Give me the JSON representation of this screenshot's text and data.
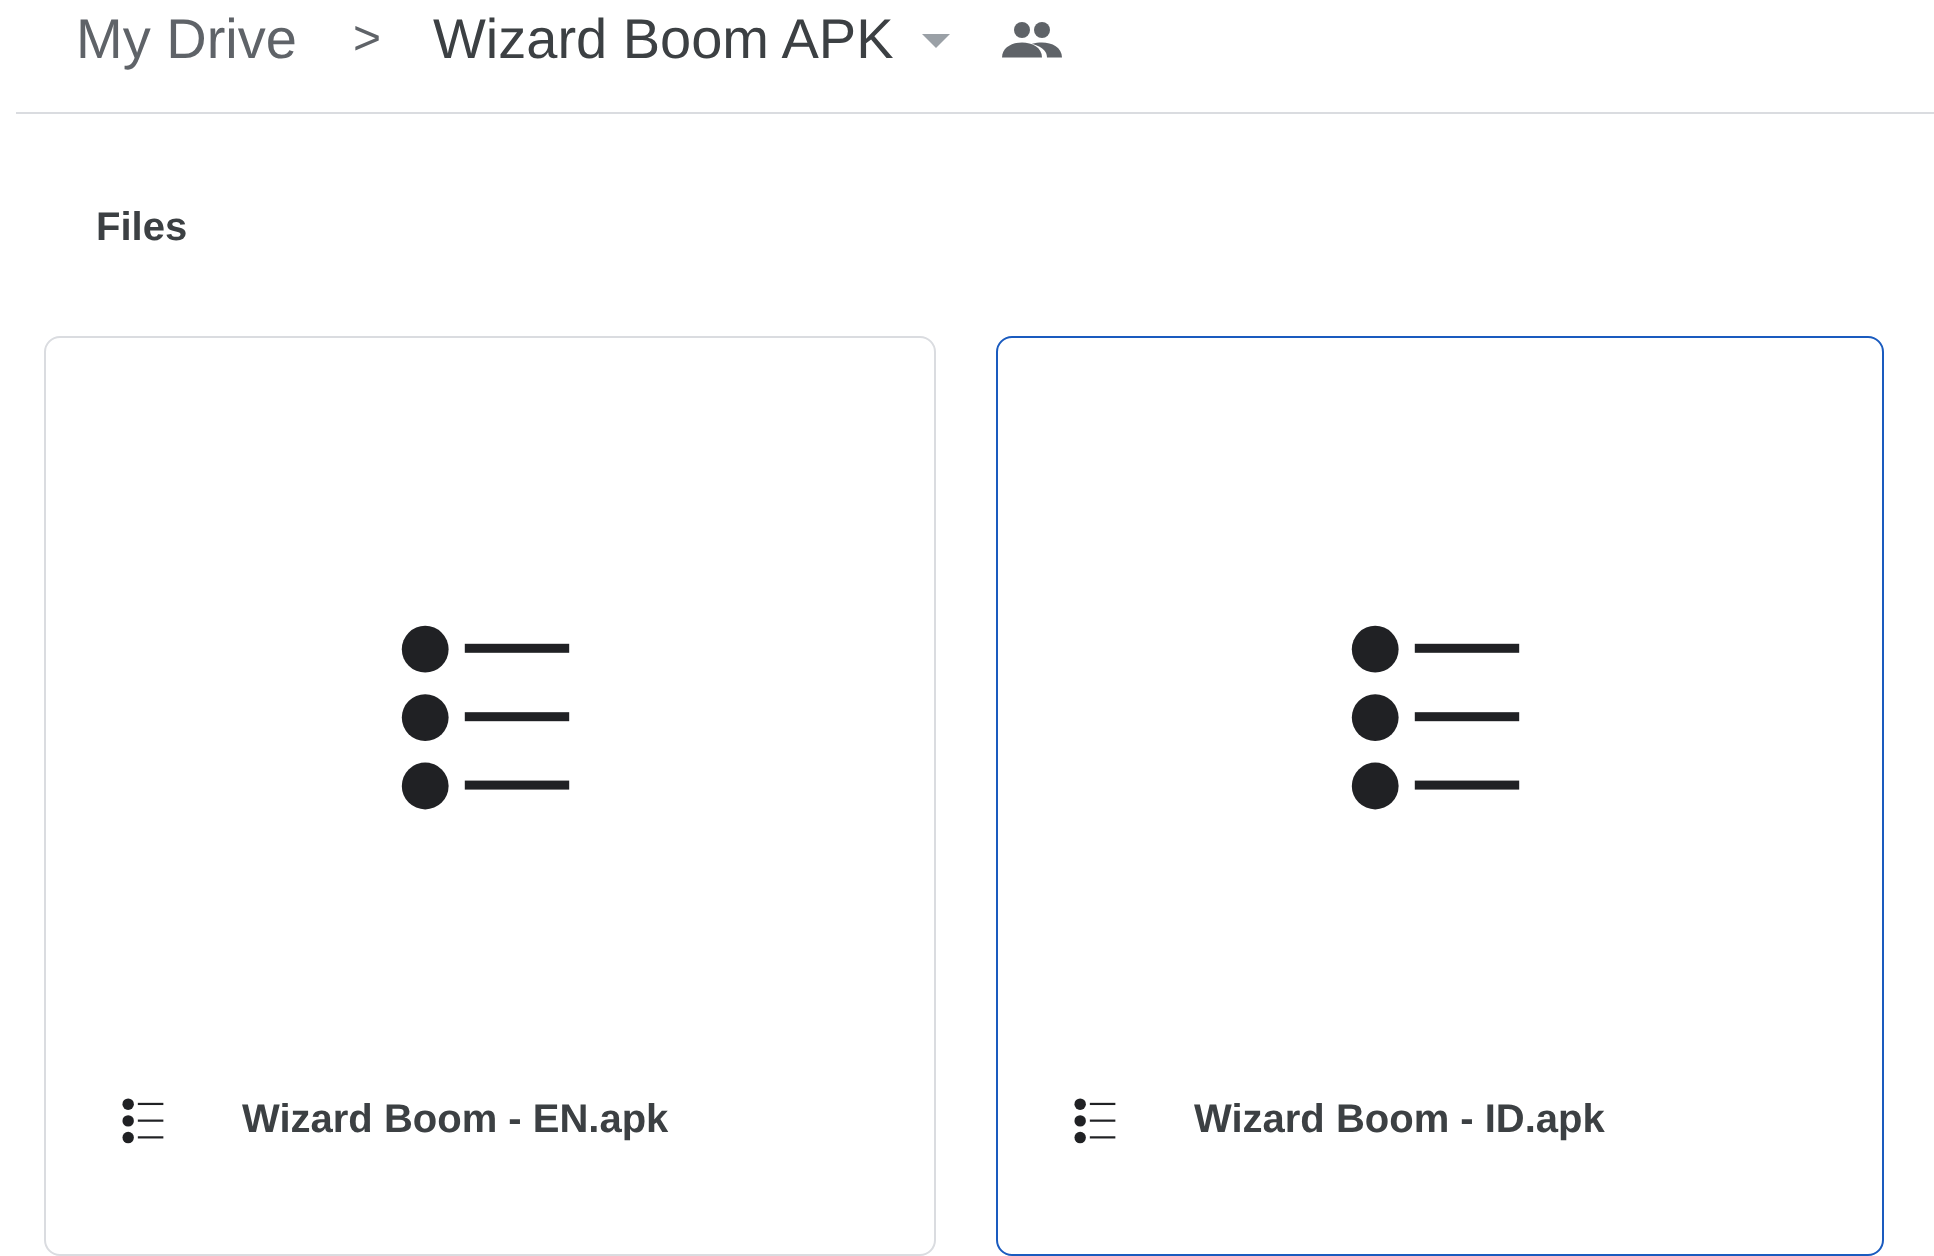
{
  "breadcrumb": {
    "root": "My Drive",
    "separator": ">",
    "current": "Wizard Boom APK"
  },
  "section_title": "Files",
  "files": [
    {
      "name": "Wizard Boom - EN.apk",
      "selected": false
    },
    {
      "name": "Wizard Boom - ID.apk",
      "selected": true
    }
  ]
}
